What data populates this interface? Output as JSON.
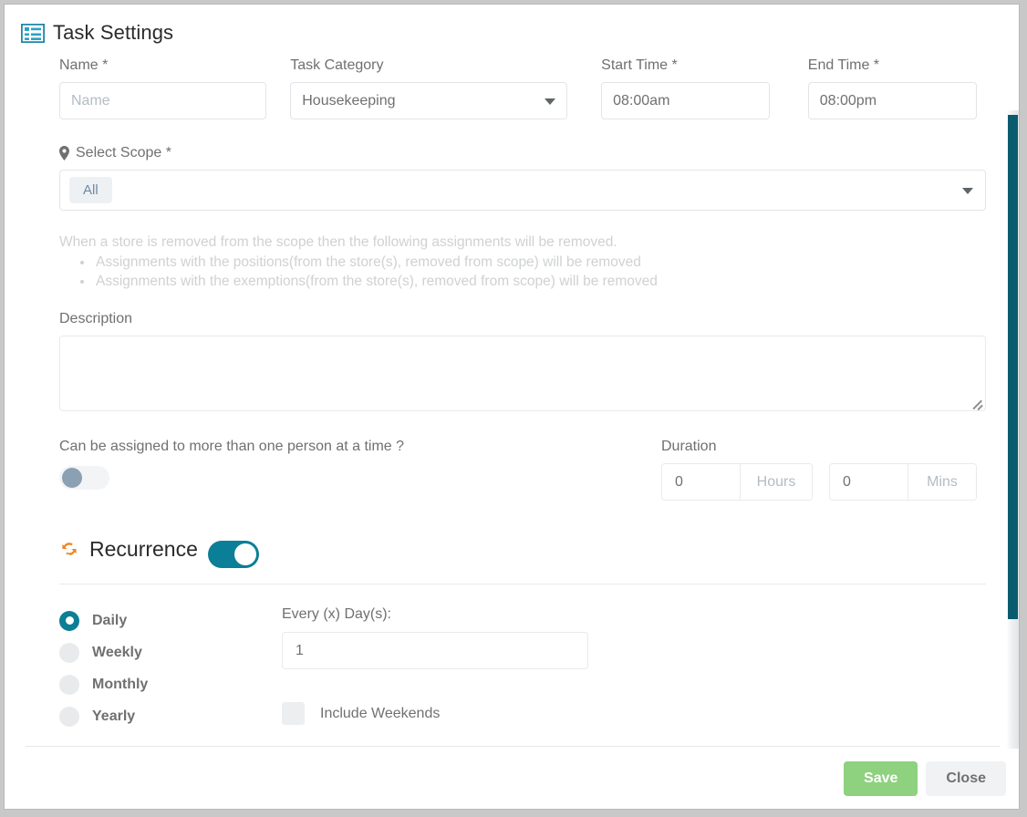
{
  "header": {
    "title": "Task Settings",
    "icon": "list-alt-icon"
  },
  "form": {
    "name": {
      "label": "Name *",
      "placeholder": "Name",
      "value": ""
    },
    "task_category": {
      "label": "Task Category",
      "value": "Housekeeping",
      "options": [
        "Housekeeping"
      ]
    },
    "start_time": {
      "label": "Start Time *",
      "value": "08:00am"
    },
    "end_time": {
      "label": "End Time *",
      "value": "08:00pm"
    },
    "scope": {
      "label": "Select Scope *",
      "icon": "map-marker-icon",
      "chips": [
        "All"
      ]
    },
    "notice": {
      "intro": "When a store is removed from the scope then the following assignments will be removed.",
      "bullets": [
        "Assignments with the positions(from the store(s), removed from scope) will be removed",
        "Assignments with the exemptions(from the store(s), removed from scope) will be removed"
      ]
    },
    "description": {
      "label": "Description",
      "value": ""
    },
    "multi_assign": {
      "label": "Can be assigned to more than one person at a time ?",
      "state": "off"
    },
    "duration": {
      "label": "Duration",
      "hours_value": "0",
      "hours_suffix": "Hours",
      "mins_value": "0",
      "mins_suffix": "Mins"
    }
  },
  "recurrence": {
    "title": "Recurrence",
    "icon": "refresh-icon",
    "toggle_state": "on",
    "options": [
      {
        "label": "Daily",
        "selected": true
      },
      {
        "label": "Weekly",
        "selected": false
      },
      {
        "label": "Monthly",
        "selected": false
      },
      {
        "label": "Yearly",
        "selected": false
      }
    ],
    "every_label": "Every (x) Day(s):",
    "every_value": "1",
    "include_weekends_label": "Include Weekends",
    "include_weekends_checked": false
  },
  "footer": {
    "save_label": "Save",
    "close_label": "Close"
  },
  "colors": {
    "accent_teal": "#0c7e95",
    "scrollbar": "#0a5b6e",
    "save_green": "#8ed17f",
    "recur_icon_orange": "#f0871f",
    "header_icon_blue": "#1e87a8",
    "label_gray": "#6f7072",
    "placeholder_gray": "#b3bcc4"
  }
}
